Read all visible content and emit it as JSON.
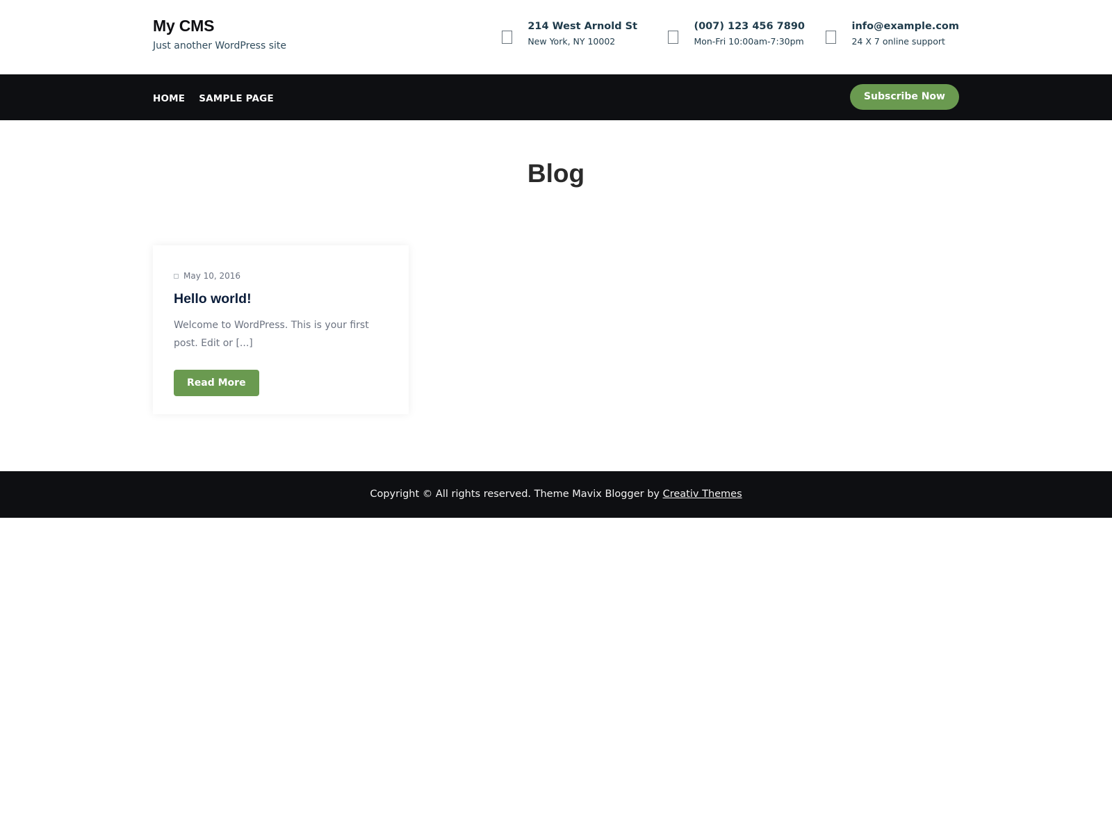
{
  "site": {
    "title": "My CMS",
    "tagline": "Just another WordPress site"
  },
  "contacts": [
    {
      "icon": "map-marker-icon",
      "line1": "214 West Arnold St",
      "line2": "New York, NY 10002"
    },
    {
      "icon": "phone-icon",
      "line1": "(007) 123 456 7890",
      "line2": "Mon-Fri 10:00am-7:30pm"
    },
    {
      "icon": "envelope-icon",
      "line1": "info@example.com",
      "line2": "24 X 7 online support"
    }
  ],
  "nav": {
    "items": [
      {
        "label": "HOME"
      },
      {
        "label": "SAMPLE PAGE"
      }
    ],
    "subscribe_label": "Subscribe Now"
  },
  "page": {
    "heading": "Blog"
  },
  "posts": [
    {
      "date": "May 10, 2016",
      "title": "Hello world!",
      "excerpt": "Welcome to WordPress. This is your first post. Edit or [...]",
      "read_more_label": "Read More"
    }
  ],
  "footer": {
    "text": "Copyright © All rights reserved. Theme Mavix Blogger by ",
    "link_text": "Creativ Themes"
  },
  "colors": {
    "accent": "#6a9a50",
    "nav_background": "#0e0f12",
    "title_dark": "#0b1d3a"
  }
}
